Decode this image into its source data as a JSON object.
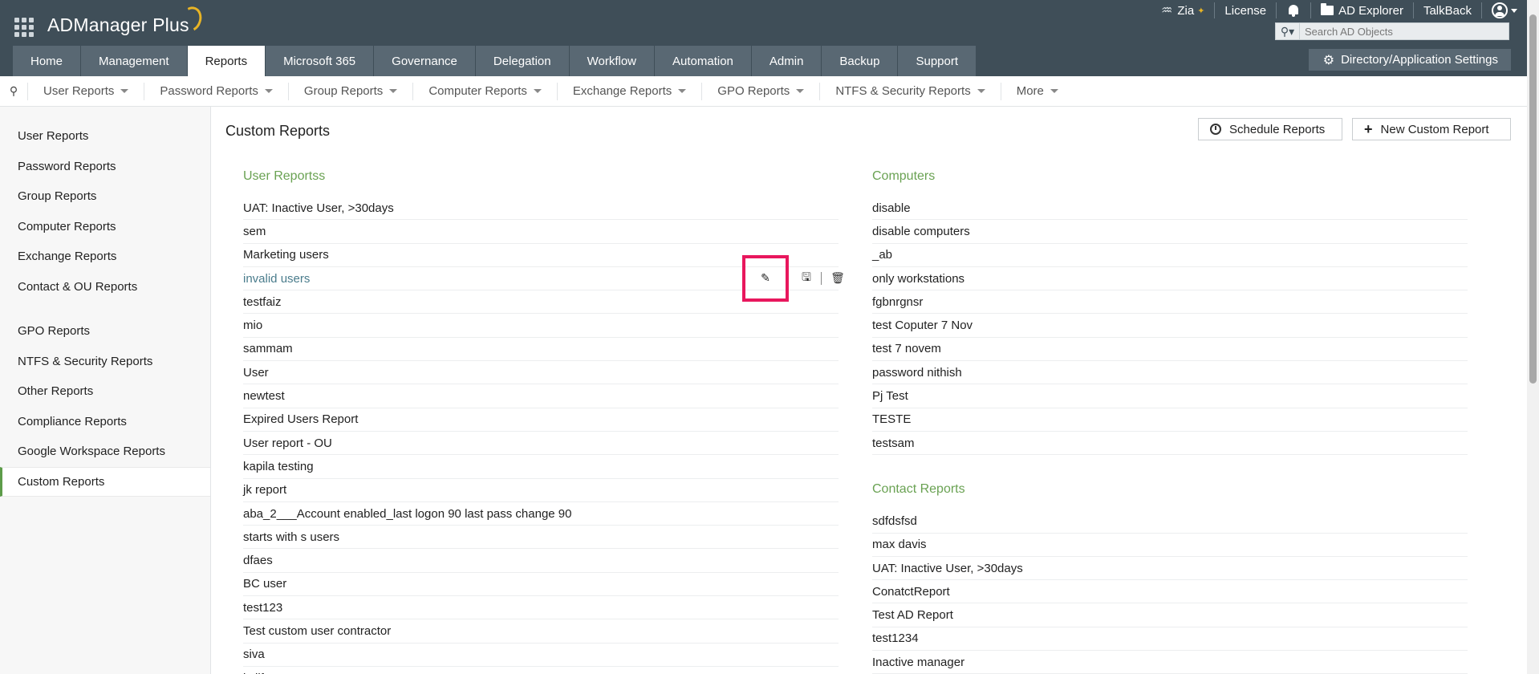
{
  "app": {
    "title": "ADManager Plus"
  },
  "top_bar": {
    "zia": "Zia",
    "license": "License",
    "ad_explorer": "AD Explorer",
    "talkback": "TalkBack",
    "search_placeholder": "Search AD Objects"
  },
  "nav": {
    "tabs": [
      "Home",
      "Management",
      "Reports",
      "Microsoft 365",
      "Governance",
      "Delegation",
      "Workflow",
      "Automation",
      "Admin",
      "Backup",
      "Support"
    ],
    "active": "Reports",
    "settings": "Directory/Application Settings"
  },
  "subnav": {
    "items": [
      "User Reports",
      "Password Reports",
      "Group Reports",
      "Computer Reports",
      "Exchange Reports",
      "GPO Reports",
      "NTFS & Security Reports",
      "More"
    ]
  },
  "sidebar": {
    "group1": [
      "User Reports",
      "Password Reports",
      "Group Reports",
      "Computer Reports",
      "Exchange Reports",
      "Contact & OU Reports"
    ],
    "group2": [
      "GPO Reports",
      "NTFS & Security Reports",
      "Other Reports",
      "Compliance Reports",
      "Google Workspace Reports",
      "Custom Reports"
    ],
    "active": "Custom Reports"
  },
  "main": {
    "title": "Custom Reports",
    "schedule_btn": "Schedule Reports",
    "new_btn": "New Custom Report",
    "user_section": {
      "title": "User Reportss",
      "items": [
        "UAT: Inactive User, >30days",
        "sem",
        "Marketing users",
        "invalid users",
        "testfaiz",
        "mio",
        "sammam",
        "User",
        "newtest",
        "Expired Users Report",
        "User report - OU",
        "kapila testing",
        "jk report",
        "aba_2___Account enabled_last logon 90 last pass change 90",
        "starts with s users",
        "dfaes",
        "BC user",
        "test123",
        "Test custom user contractor",
        "siva",
        "kvjif"
      ],
      "highlighted_index": 3
    },
    "computer_section": {
      "title": "Computers",
      "items": [
        "disable",
        "disable computers",
        "_ab",
        "only workstations",
        "fgbnrgnsr",
        "test Coputer 7 Nov",
        "test 7 novem",
        "password nithish",
        "Pj Test",
        "TESTE",
        "testsam"
      ]
    },
    "contact_section": {
      "title": "Contact Reports",
      "items": [
        "sdfdsfsd",
        "max davis",
        "UAT: Inactive User, >30days",
        "ConatctReport",
        "Test AD Report",
        "test1234",
        "Inactive manager"
      ]
    }
  }
}
